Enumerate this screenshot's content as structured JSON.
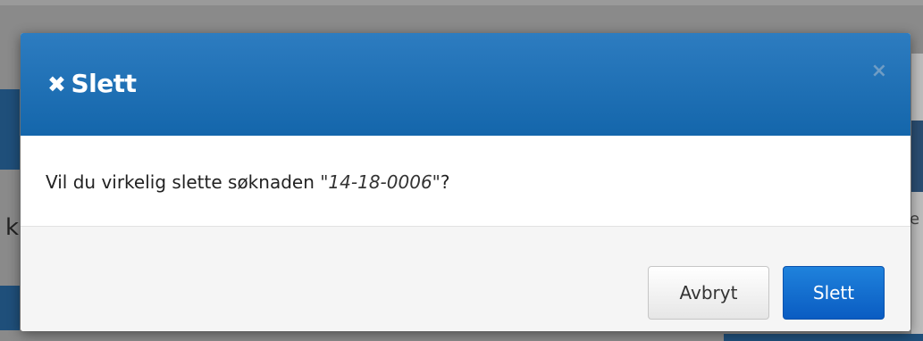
{
  "dialog": {
    "title": "Slett",
    "close_symbol": "×",
    "message_prefix": "Vil du virkelig slette søknaden ",
    "item_name": "\"14-18-0006\"",
    "message_suffix": "?",
    "cancel_label": "Avbryt",
    "delete_label": "Slett"
  },
  "background": {
    "left_glyph": "k",
    "right_glyph": "e"
  },
  "icons": {
    "title_icon": "close-icon",
    "close_button_icon": "close-icon"
  },
  "colors": {
    "header_blue": "#1a6db4",
    "primary_button": "#0a5cc2",
    "footer_bg": "#f5f5f5"
  }
}
